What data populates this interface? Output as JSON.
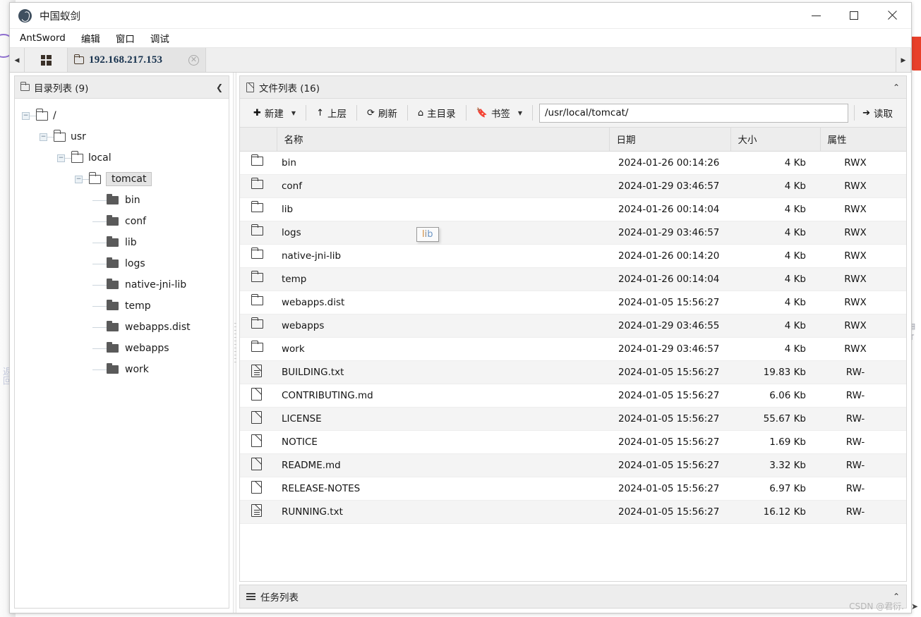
{
  "window": {
    "title": "中国蚁剑",
    "logo_icon": "antsword-logo-icon",
    "minimize_label": "–",
    "maximize_label": "□",
    "close_label": "✕"
  },
  "menubar": {
    "items": [
      {
        "label": "AntSword"
      },
      {
        "label": "编辑"
      },
      {
        "label": "窗口"
      },
      {
        "label": "调试"
      }
    ]
  },
  "tabs": {
    "prev_arrow": "◀",
    "next_arrow": "▶",
    "grid_label": "grid-icon",
    "active": {
      "label": "192.168.217.153",
      "close": "✕"
    }
  },
  "left_panel": {
    "title": "目录列表 (9)",
    "collapse_label": "❮",
    "tree": [
      {
        "label": "/",
        "depth": 0,
        "expander": "−",
        "icon": "folder-outline",
        "selected": false
      },
      {
        "label": "usr",
        "depth": 1,
        "expander": "−",
        "icon": "folder-outline",
        "selected": false
      },
      {
        "label": "local",
        "depth": 2,
        "expander": "−",
        "icon": "folder-outline",
        "selected": false
      },
      {
        "label": "tomcat",
        "depth": 3,
        "expander": "−",
        "icon": "folder-outline",
        "selected": true
      },
      {
        "label": "bin",
        "depth": 4,
        "expander": "",
        "icon": "folder-solid",
        "selected": false
      },
      {
        "label": "conf",
        "depth": 4,
        "expander": "",
        "icon": "folder-solid",
        "selected": false
      },
      {
        "label": "lib",
        "depth": 4,
        "expander": "",
        "icon": "folder-solid",
        "selected": false
      },
      {
        "label": "logs",
        "depth": 4,
        "expander": "",
        "icon": "folder-solid",
        "selected": false
      },
      {
        "label": "native-jni-lib",
        "depth": 4,
        "expander": "",
        "icon": "folder-solid",
        "selected": false
      },
      {
        "label": "temp",
        "depth": 4,
        "expander": "",
        "icon": "folder-solid",
        "selected": false
      },
      {
        "label": "webapps.dist",
        "depth": 4,
        "expander": "",
        "icon": "folder-solid",
        "selected": false
      },
      {
        "label": "webapps",
        "depth": 4,
        "expander": "",
        "icon": "folder-solid",
        "selected": false
      },
      {
        "label": "work",
        "depth": 4,
        "expander": "",
        "icon": "folder-solid",
        "selected": false
      }
    ]
  },
  "files_panel": {
    "title": "文件列表 (16)",
    "collapse_label": "⌃",
    "toolbar": {
      "new_label": "新建",
      "new_icon": "plus-circle-icon",
      "new_caret": "▼",
      "up_label": "上层",
      "up_icon": "arrow-up-icon",
      "refresh_label": "刷新",
      "refresh_icon": "refresh-icon",
      "home_label": "主目录",
      "home_icon": "home-icon",
      "bookmark_label": "书签",
      "bookmark_icon": "bookmark-icon",
      "bookmark_caret": "▼",
      "path_value": "/usr/local/tomcat/",
      "path_placeholder": "/",
      "read_label": "读取",
      "read_icon": "arrow-right-icon"
    },
    "columns": {
      "icon": "",
      "name": "名称",
      "date": "日期",
      "size": "大小",
      "attr": "属性"
    },
    "rows": [
      {
        "icon": "folder-icon",
        "name": "bin",
        "date": "2024-01-26 00:14:26",
        "size": "4 Kb",
        "attr": "RWX"
      },
      {
        "icon": "folder-icon",
        "name": "conf",
        "date": "2024-01-29 03:46:57",
        "size": "4 Kb",
        "attr": "RWX"
      },
      {
        "icon": "folder-icon",
        "name": "lib",
        "date": "2024-01-26 00:14:04",
        "size": "4 Kb",
        "attr": "RWX"
      },
      {
        "icon": "folder-icon",
        "name": "logs",
        "date": "2024-01-29 03:46:57",
        "size": "4 Kb",
        "attr": "RWX"
      },
      {
        "icon": "folder-icon",
        "name": "native-jni-lib",
        "date": "2024-01-26 00:14:20",
        "size": "4 Kb",
        "attr": "RWX"
      },
      {
        "icon": "folder-icon",
        "name": "temp",
        "date": "2024-01-26 00:14:04",
        "size": "4 Kb",
        "attr": "RWX"
      },
      {
        "icon": "folder-icon",
        "name": "webapps.dist",
        "date": "2024-01-05 15:56:27",
        "size": "4 Kb",
        "attr": "RWX"
      },
      {
        "icon": "folder-icon",
        "name": "webapps",
        "date": "2024-01-29 03:46:55",
        "size": "4 Kb",
        "attr": "RWX"
      },
      {
        "icon": "folder-icon",
        "name": "work",
        "date": "2024-01-29 03:46:57",
        "size": "4 Kb",
        "attr": "RWX"
      },
      {
        "icon": "text-file-icon",
        "name": "BUILDING.txt",
        "date": "2024-01-05 15:56:27",
        "size": "19.83 Kb",
        "attr": "RW-"
      },
      {
        "icon": "file-icon",
        "name": "CONTRIBUTING.md",
        "date": "2024-01-05 15:56:27",
        "size": "6.06 Kb",
        "attr": "RW-"
      },
      {
        "icon": "file-icon",
        "name": "LICENSE",
        "date": "2024-01-05 15:56:27",
        "size": "55.67 Kb",
        "attr": "RW-"
      },
      {
        "icon": "file-icon",
        "name": "NOTICE",
        "date": "2024-01-05 15:56:27",
        "size": "1.69 Kb",
        "attr": "RW-"
      },
      {
        "icon": "file-icon",
        "name": "README.md",
        "date": "2024-01-05 15:56:27",
        "size": "3.32 Kb",
        "attr": "RW-"
      },
      {
        "icon": "file-icon",
        "name": "RELEASE-NOTES",
        "date": "2024-01-05 15:56:27",
        "size": "6.97 Kb",
        "attr": "RW-"
      },
      {
        "icon": "text-file-icon",
        "name": "RUNNING.txt",
        "date": "2024-01-05 15:56:27",
        "size": "16.12 Kb",
        "attr": "RW-"
      }
    ]
  },
  "tooltip": {
    "part1": "l",
    "part2": "i",
    "part3": "b"
  },
  "tasklist": {
    "title": "任务列表",
    "collapse_label": "⌃"
  },
  "watermark": {
    "text": "CSDN @君衍."
  },
  "background": {
    "left_text": "返回",
    "right_icons": "参\nT"
  },
  "colors": {
    "accent": "#16314d",
    "window_bg": "#f1f1f1",
    "header_bg": "#ededed",
    "row_alt": "#f4f4f4",
    "selection": "#e4e4e4",
    "ribbon_red": "#e8402a"
  }
}
